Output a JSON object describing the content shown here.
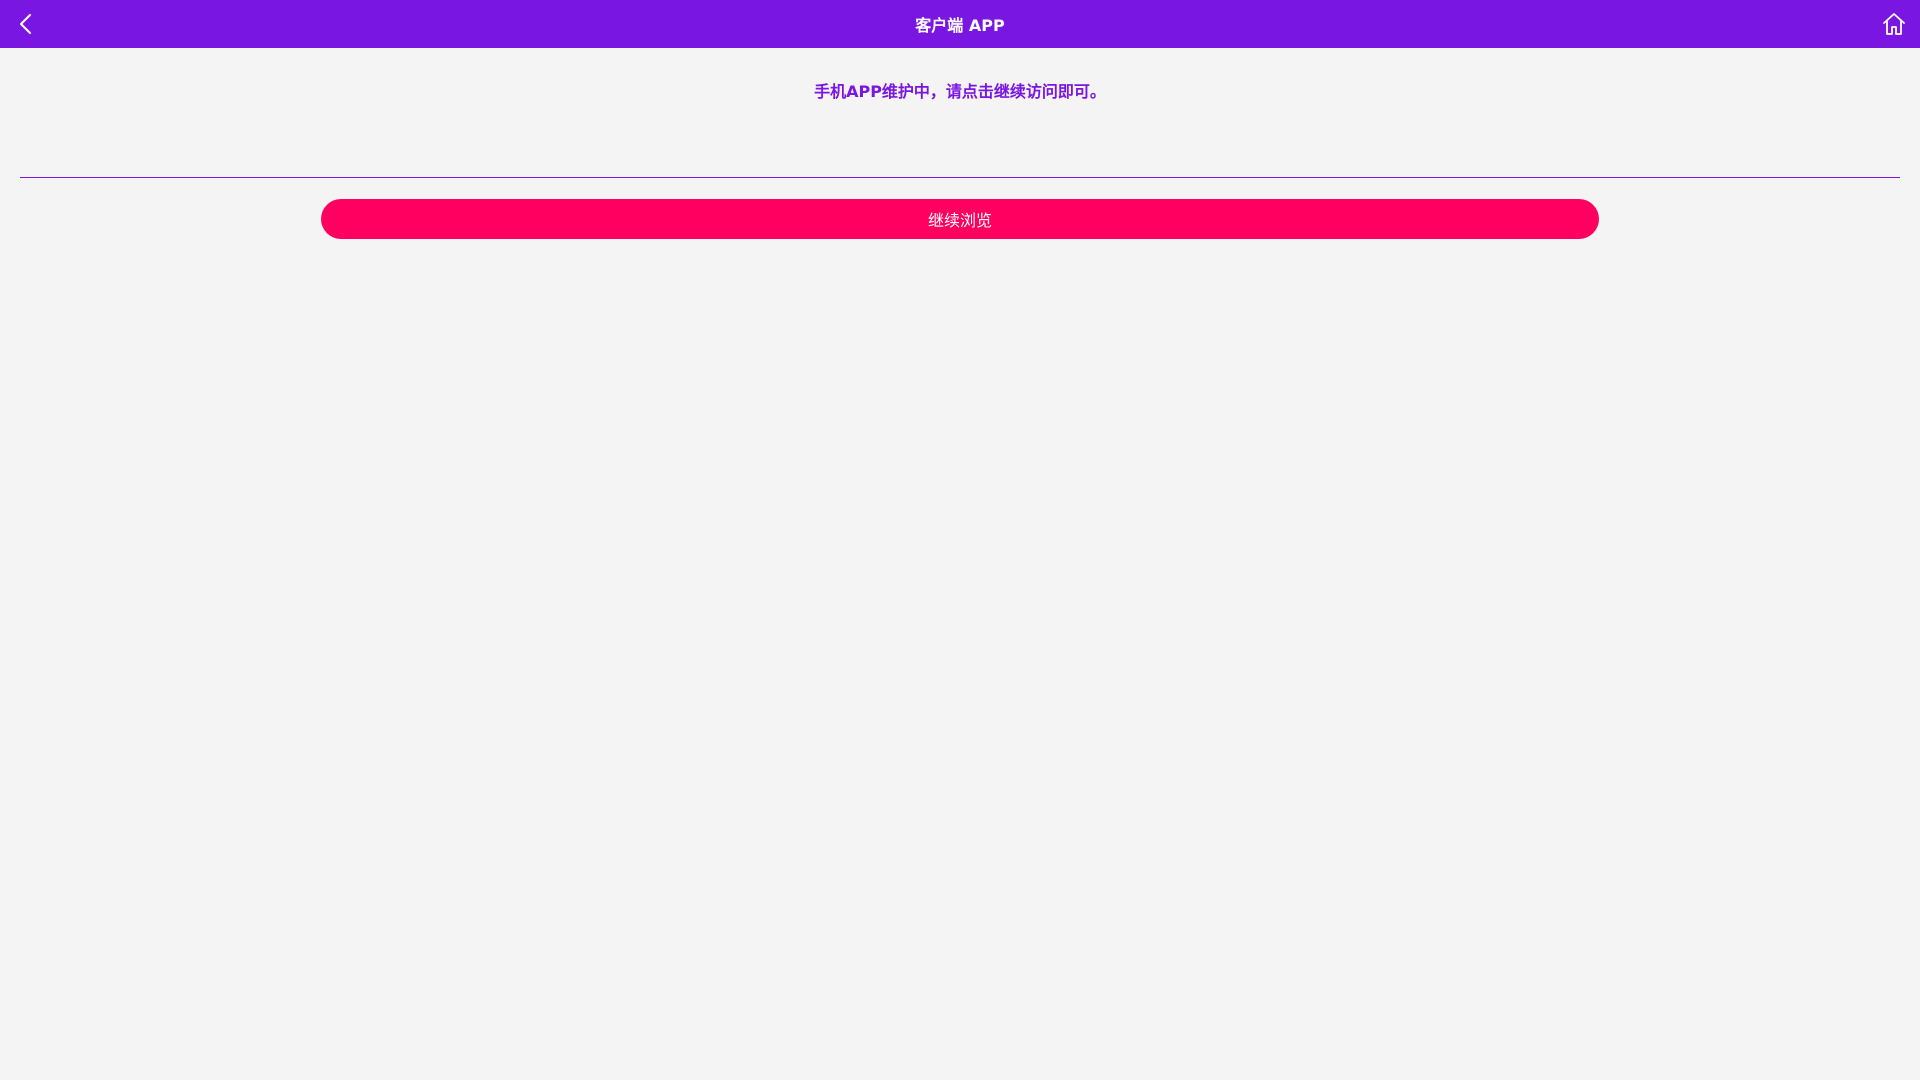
{
  "header": {
    "title": "客户端 APP",
    "back_icon": "chevron-left-icon",
    "home_icon": "home-icon",
    "background_color": "#7a16e2"
  },
  "main": {
    "notice_text": "手机APP维护中，请点击继续访问即可。",
    "notice_color": "#7a16e2",
    "continue_button_label": "继续浏览",
    "continue_button_color": "#ff0060"
  }
}
